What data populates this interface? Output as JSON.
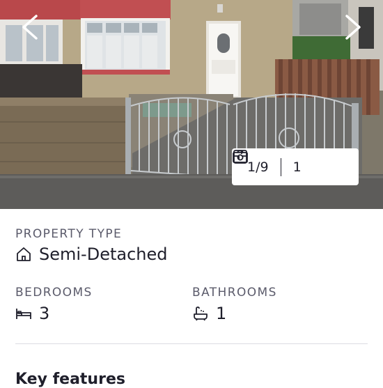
{
  "gallery": {
    "photo_alt": "Front of semi-detached house with stone wall and iron gate",
    "counter": {
      "photos": "1/9",
      "floorplans": "1"
    }
  },
  "details": {
    "property_type_label": "PROPERTY TYPE",
    "property_type_value": "Semi-Detached",
    "bedrooms_label": "BEDROOMS",
    "bedrooms_value": "3",
    "bathrooms_label": "BATHROOMS",
    "bathrooms_value": "1"
  },
  "section_title": "Key features",
  "icons": [
    "chevron-left-icon",
    "chevron-right-icon",
    "camera-icon",
    "floorplan-icon",
    "house-icon",
    "bed-icon",
    "bath-icon"
  ]
}
